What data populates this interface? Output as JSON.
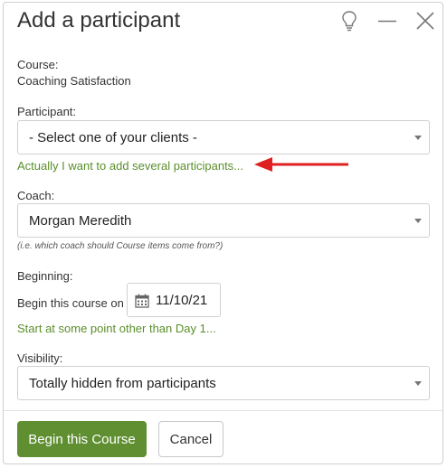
{
  "dialog": {
    "title": "Add a participant",
    "icons": [
      "lightbulb-icon",
      "minimize-icon",
      "close-icon"
    ]
  },
  "course": {
    "label": "Course:",
    "value": "Coaching Satisfaction"
  },
  "participant": {
    "label": "Participant:",
    "selected": "- Select one of your clients -",
    "add_several_link": "Actually I want to add several participants..."
  },
  "coach": {
    "label": "Coach:",
    "selected": "Morgan Meredith",
    "hint": "(i.e. which coach should Course items come from?)"
  },
  "beginning": {
    "label": "Beginning:",
    "begin_text": "Begin this course on",
    "date": "11/10/21",
    "other_day_link": "Start at some point other than Day 1..."
  },
  "visibility": {
    "label": "Visibility:",
    "selected": "Totally hidden from participants"
  },
  "footer": {
    "primary_label": "Begin this Course",
    "cancel_label": "Cancel"
  },
  "colors": {
    "accent_green": "#5f8f31",
    "link_green": "#5a8f2a",
    "annotation_red": "#e02020"
  }
}
